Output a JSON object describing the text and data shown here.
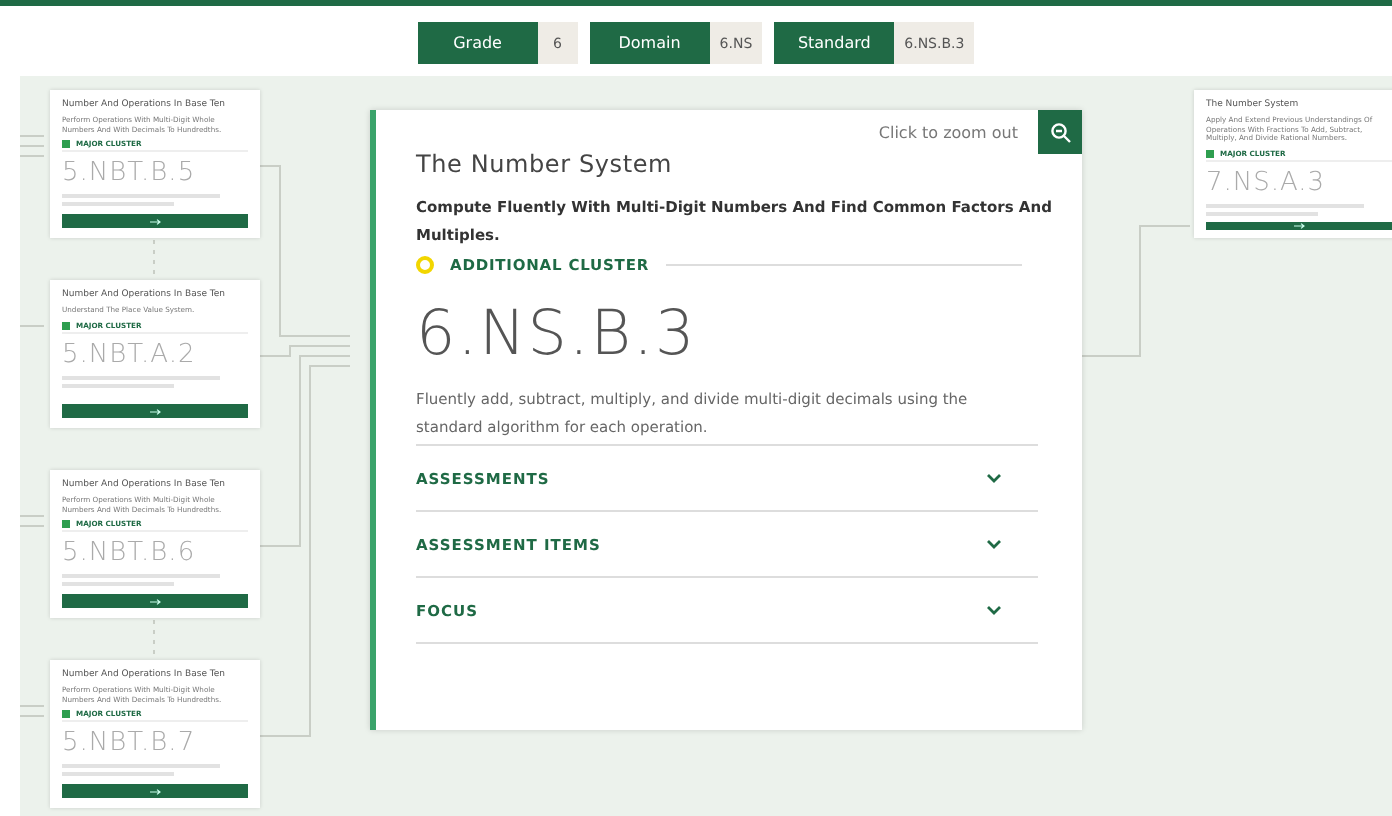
{
  "filters": [
    {
      "label": "Grade",
      "value": "6"
    },
    {
      "label": "Domain",
      "value": "6.NS"
    },
    {
      "label": "Standard",
      "value": "6.NS.B.3"
    }
  ],
  "left_cards": [
    {
      "title": "Number And Operations In Base Ten",
      "subtitle": "Perform Operations With Multi-Digit Whole Numbers And With Decimals To Hundredths.",
      "cluster": "MAJOR CLUSTER",
      "code": "5.NBT.B.5",
      "color": "#2e9e4f"
    },
    {
      "title": "Number And Operations In Base Ten",
      "subtitle": "Understand The Place Value System.",
      "cluster": "MAJOR CLUSTER",
      "code": "5.NBT.A.2",
      "color": "#2e9e4f"
    },
    {
      "title": "Number And Operations In Base Ten",
      "subtitle": "Perform Operations With Multi-Digit Whole Numbers And With Decimals To Hundredths.",
      "cluster": "MAJOR CLUSTER",
      "code": "5.NBT.B.6",
      "color": "#2e9e4f"
    },
    {
      "title": "Number And Operations In Base Ten",
      "subtitle": "Perform Operations With Multi-Digit Whole Numbers And With Decimals To Hundredths.",
      "cluster": "MAJOR CLUSTER",
      "code": "5.NBT.B.7",
      "color": "#2e9e4f"
    }
  ],
  "main_card": {
    "zoom_hint": "Click to zoom out",
    "domain": "The Number System",
    "cluster_title": "Compute Fluently With Multi-Digit Numbers And Find Common Factors And Multiples.",
    "cluster": "ADDITIONAL CLUSTER",
    "color": "#f2d600",
    "code": "6.NS.B.3",
    "description": "Fluently add, subtract, multiply, and divide multi-digit decimals using the standard algorithm for each operation.",
    "sections": [
      {
        "label": "ASSESSMENTS",
        "expanded": false
      },
      {
        "label": "ASSESSMENT ITEMS",
        "expanded": false
      },
      {
        "label": "FOCUS",
        "expanded": false
      }
    ]
  },
  "right_card": {
    "title": "The Number System",
    "subtitle": "Apply And Extend Previous Understandings Of Operations With Fractions To Add, Subtract, Multiply, And Divide Rational Numbers.",
    "cluster": "MAJOR CLUSTER",
    "code": "7.NS.A.3",
    "color": "#2e9e4f"
  }
}
